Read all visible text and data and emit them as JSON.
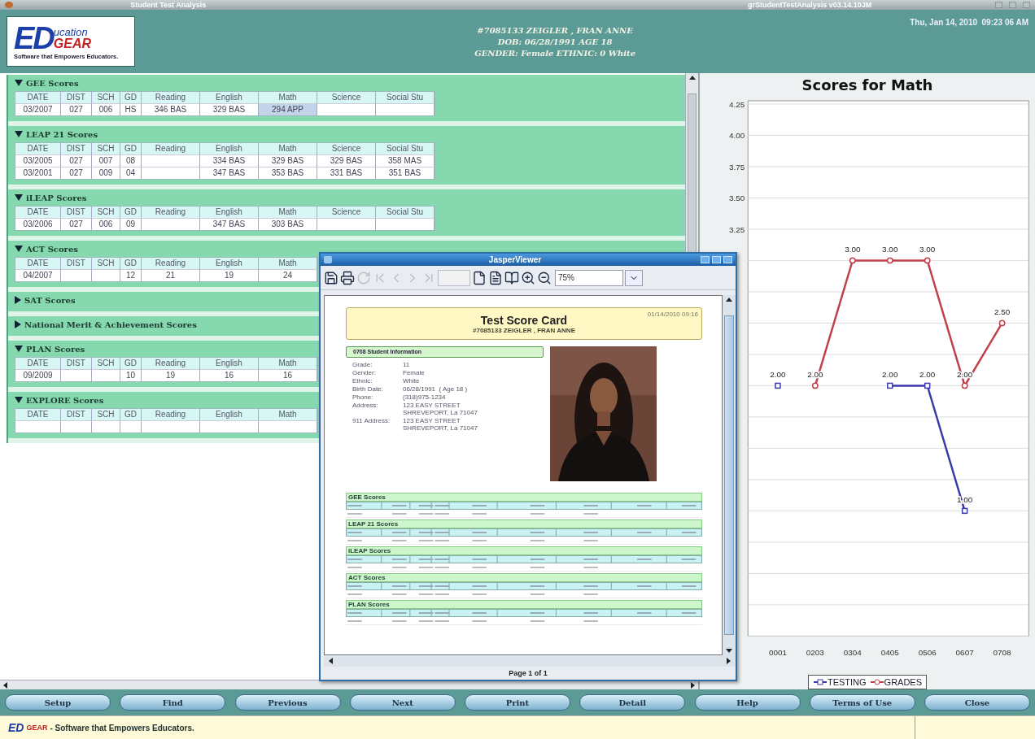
{
  "window": {
    "title": "Student Test Analysis",
    "version": "grStudentTestAnalysis v03.14.10JM"
  },
  "header": {
    "logo": {
      "big": "ED",
      "small_top": "ucation",
      "small_bottom": "GEAR",
      "tagline": "Software that Empowers Educators."
    },
    "student": [
      "#7085133 ZEIGLER , FRAN ANNE",
      "DOB: 06/28/1991 AGE 18",
      "GENDER: Female ETHNIC: 0 White"
    ],
    "datetime": "Thu, Jan 14, 2010  09:23 06 AM"
  },
  "sections": [
    {
      "title": "GEE Scores",
      "expanded": true,
      "columns": [
        "DATE",
        "DIST",
        "SCH",
        "GD",
        "Reading",
        "English",
        "Math",
        "Science",
        "Social Stu"
      ],
      "rows": [
        [
          {
            "text": "03/2007",
            "selected": false
          },
          {
            "text": "027",
            "selected": false
          },
          {
            "text": "006",
            "selected": false
          },
          {
            "text": "HS",
            "selected": false
          },
          {
            "text": "346 BAS",
            "selected": false
          },
          {
            "text": "329 BAS",
            "selected": false
          },
          {
            "text": "294 APP",
            "selected": true
          },
          {
            "selected": false
          },
          {
            "selected": false
          }
        ]
      ]
    },
    {
      "title": "LEAP 21 Scores",
      "expanded": true,
      "columns": [
        "DATE",
        "DIST",
        "SCH",
        "GD",
        "Reading",
        "English",
        "Math",
        "Science",
        "Social Stu"
      ],
      "rows": [
        [
          {
            "text": "03/2005",
            "selected": false
          },
          {
            "text": "027",
            "selected": false
          },
          {
            "text": "007",
            "selected": false
          },
          {
            "text": "08",
            "selected": false
          },
          {
            "selected": false
          },
          {
            "text": "334 BAS",
            "selected": false
          },
          {
            "text": "329 BAS",
            "selected": false
          },
          {
            "text": "329 BAS",
            "selected": false
          },
          {
            "text": "358 MAS",
            "selected": false
          }
        ],
        [
          {
            "text": "03/2001",
            "selected": false
          },
          {
            "text": "027",
            "selected": false
          },
          {
            "text": "009",
            "selected": false
          },
          {
            "text": "04",
            "selected": false
          },
          {
            "selected": false
          },
          {
            "text": "347 BAS",
            "selected": false
          },
          {
            "text": "353 BAS",
            "selected": false
          },
          {
            "text": "331 BAS",
            "selected": false
          },
          {
            "text": "351 BAS",
            "selected": false
          }
        ]
      ]
    },
    {
      "title": "iLEAP Scores",
      "expanded": true,
      "columns": [
        "DATE",
        "DIST",
        "SCH",
        "GD",
        "Reading",
        "English",
        "Math",
        "Science",
        "Social Stu"
      ],
      "rows": [
        [
          {
            "text": "03/2006",
            "selected": false
          },
          {
            "text": "027",
            "selected": false
          },
          {
            "text": "006",
            "selected": false
          },
          {
            "text": "09",
            "selected": false
          },
          {
            "selected": false
          },
          {
            "text": "347 BAS",
            "selected": false
          },
          {
            "text": "303 BAS",
            "selected": false
          },
          {
            "selected": false
          },
          {
            "selected": false
          }
        ]
      ]
    },
    {
      "title": "ACT Scores",
      "expanded": true,
      "columns": [
        "DATE",
        "DIST",
        "SCH",
        "GD",
        "Reading",
        "English",
        "Math"
      ],
      "rows": [
        [
          {
            "text": "04/2007",
            "selected": false
          },
          {
            "selected": false
          },
          {
            "selected": false
          },
          {
            "text": "12",
            "selected": false
          },
          {
            "text": "21",
            "selected": false
          },
          {
            "text": "19",
            "selected": false
          },
          {
            "text": "24",
            "selected": false
          }
        ]
      ]
    },
    {
      "title": "SAT Scores",
      "expanded": false
    },
    {
      "title": "National Merit & Achievement Scores",
      "expanded": false
    },
    {
      "title": "PLAN Scores",
      "expanded": true,
      "columns": [
        "DATE",
        "DIST",
        "SCH",
        "GD",
        "Reading",
        "English",
        "Math"
      ],
      "rows": [
        [
          {
            "text": "09/2009",
            "selected": false
          },
          {
            "selected": false
          },
          {
            "selected": false
          },
          {
            "text": "10",
            "selected": false
          },
          {
            "text": "19",
            "selected": false
          },
          {
            "text": "16",
            "selected": false
          },
          {
            "text": "16",
            "selected": false
          }
        ]
      ]
    },
    {
      "title": "EXPLORE Scores",
      "expanded": true,
      "columns": [
        "DATE",
        "DIST",
        "SCH",
        "GD",
        "Reading",
        "English",
        "Math"
      ]
    }
  ],
  "chart": {
    "chart_data": {
      "type": "line",
      "title": "Scores for Math",
      "categories": [
        "0001",
        "0203",
        "0304",
        "0405",
        "0506",
        "0607",
        "0708"
      ],
      "series": [
        {
          "name": "TESTING",
          "color": "#3b3ba8",
          "marker": "square",
          "values": [
            2,
            null,
            null,
            2,
            2,
            1,
            null
          ],
          "value_labels": [
            "2.00",
            null,
            null,
            "2.00",
            "2.00",
            "1.00",
            null
          ]
        },
        {
          "name": "GRADES",
          "color": "#c0404a",
          "marker": "circle",
          "values": [
            null,
            2,
            3,
            3,
            3,
            2,
            2.5
          ],
          "value_labels": [
            null,
            "2.00",
            "3.00",
            "3.00",
            "3.00",
            "2.00",
            "2.50"
          ]
        }
      ],
      "ylim": [
        0,
        4.25
      ],
      "yticks": [
        {
          "value": 3.25,
          "label": "3.25"
        },
        {
          "value": 3.5,
          "label": "3.50"
        },
        {
          "value": 3.75,
          "label": "3.75"
        },
        {
          "value": 4,
          "label": "4.00"
        },
        {
          "value": 4.25,
          "label": "4.25"
        }
      ],
      "grid": true
    }
  },
  "buttons": [
    "Setup",
    "Find",
    "Previous",
    "Next",
    "Print",
    "Detail",
    "Help",
    "Terms of Use",
    "Close"
  ],
  "status_bar": {
    "brand_ed": "ED",
    "brand_gear": "GEAR",
    "text": "- Software that Empowers Educators."
  },
  "viewer": {
    "title": "JasperViewer",
    "toolbar": [
      {
        "kind": "save",
        "disabled": false
      },
      {
        "kind": "print",
        "disabled": false
      },
      {
        "kind": "reload",
        "disabled": true
      },
      {
        "kind": "first",
        "disabled": true
      },
      {
        "kind": "previous",
        "disabled": true
      },
      {
        "kind": "next",
        "disabled": true
      },
      {
        "kind": "last",
        "disabled": true
      },
      {
        "kind": "page_field",
        "disabled": true
      },
      {
        "kind": "actual_size",
        "disabled": false
      },
      {
        "kind": "fit_page",
        "disabled": false
      },
      {
        "kind": "fit_width",
        "disabled": false
      },
      {
        "kind": "zoom_in",
        "disabled": false
      },
      {
        "kind": "zoom_out",
        "disabled": false
      }
    ],
    "zoom": "75%",
    "footer": "Page 1 of 1",
    "report": {
      "title": "Test Score Card",
      "subtitle": "#7085133 ZEIGLER , FRAN ANNE",
      "printed": "01/14/2010 09:16",
      "info_title": "0708 Student Information",
      "info": [
        {
          "label": "Grade:",
          "lines": [
            "11"
          ]
        },
        {
          "label": "Gender:",
          "lines": [
            "Female"
          ]
        },
        {
          "label": "Ethnic:",
          "lines": [
            "White"
          ]
        },
        {
          "label": "Birth Date:",
          "lines": [
            "06/28/1991  ( Age 18 )"
          ]
        },
        {
          "label": "Phone:",
          "lines": [
            "(318)975-1234"
          ]
        },
        {
          "label": "Address:",
          "lines": [
            "123 EASY STREET",
            "SHREVEPORT, La 71047"
          ]
        },
        {
          "label": "911 Address:",
          "lines": [
            "123 EASY STREET",
            "SHREVEPORT, La 71047"
          ]
        }
      ],
      "tables": [
        {
          "title": "GEE Scores"
        },
        {
          "title": "LEAP 21 Scores"
        },
        {
          "title": "iLEAP Scores"
        },
        {
          "title": "ACT Scores"
        },
        {
          "title": "PLAN Scores"
        }
      ]
    }
  }
}
